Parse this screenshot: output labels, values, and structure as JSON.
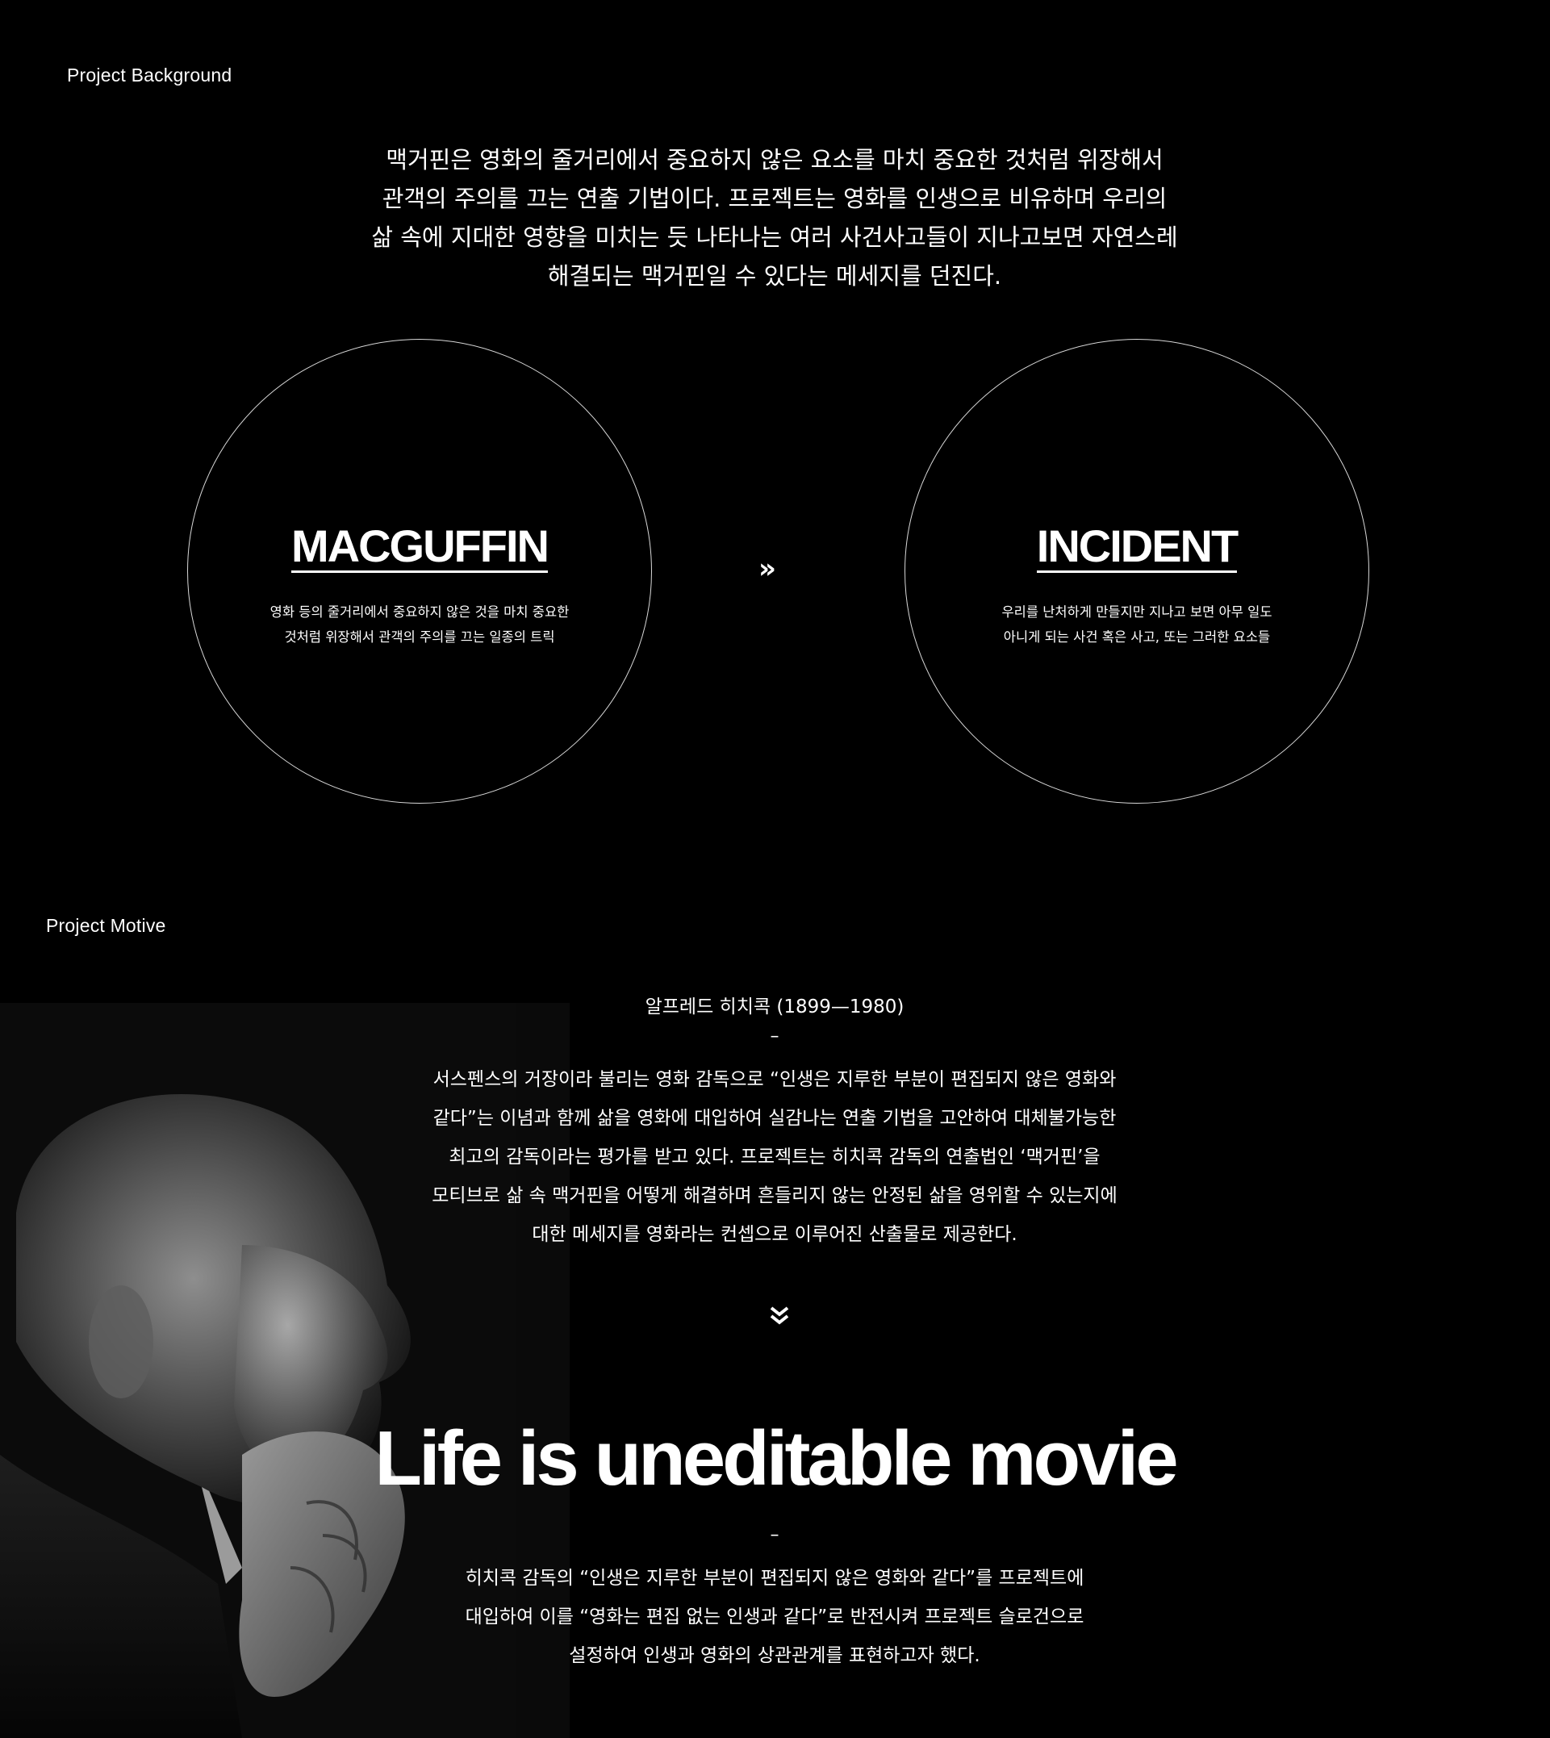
{
  "background": {
    "label": "Project Background",
    "intro_lines": [
      "맥거핀은 영화의 줄거리에서 중요하지 않은 요소를 마치 중요한 것처럼 위장해서",
      "관객의 주의를 끄는 연출 기법이다. 프로젝트는 영화를 인생으로 비유하며 우리의",
      "삶 속에 지대한 영향을 미치는 듯 나타나는 여러 사건사고들이 지나고보면 자연스레",
      "해결되는 맥거핀일 수 있다는 메세지를 던진다."
    ],
    "circles": [
      {
        "title": "MACGUFFIN",
        "desc_lines": [
          "영화 등의 줄거리에서 중요하지 않은 것을 마치 중요한",
          "것처럼 위장해서 관객의 주의를 끄는 일종의 트릭"
        ]
      },
      {
        "title": "INCIDENT",
        "desc_lines": [
          "우리를 난처하게 만들지만 지나고 보면 아무 일도",
          "아니게 되는 사건 혹은 사고, 또는 그러한 요소들"
        ]
      }
    ],
    "arrow": "»"
  },
  "motive": {
    "label": "Project Motive",
    "title": "알프레드 히치콕 (1899—1980)",
    "dash": "–",
    "body_lines": [
      "서스펜스의 거장이라 불리는 영화 감독으로 “인생은 지루한 부분이 편집되지 않은 영화와",
      "같다”는 이념과 함께 삶을 영화에 대입하여 실감나는 연출 기법을 고안하여 대체불가능한",
      "최고의 감독이라는 평가를 받고 있다. 프로젝트는 히치콕 감독의 연출법인 ‘맥거핀’을",
      "모티브로 삶 속 맥거핀을 어떻게 해결하며 흔들리지 않는 안정된 삶을 영위할 수 있는지에",
      "대한 메세지를 영화라는 컨셉으로 이루어진 산출물로 제공한다."
    ]
  },
  "slogan": {
    "title": "Life is uneditable movie",
    "dash": "–",
    "body_lines": [
      "히치콕 감독의 “인생은 지루한 부분이 편집되지 않은 영화와 같다”를 프로젝트에",
      "대입하여 이를 “영화는 편집 없는 인생과 같다”로 반전시켜 프로젝트 슬로건으로",
      "설정하여 인생과 영화의 상관관계를 표현하고자 했다."
    ]
  }
}
